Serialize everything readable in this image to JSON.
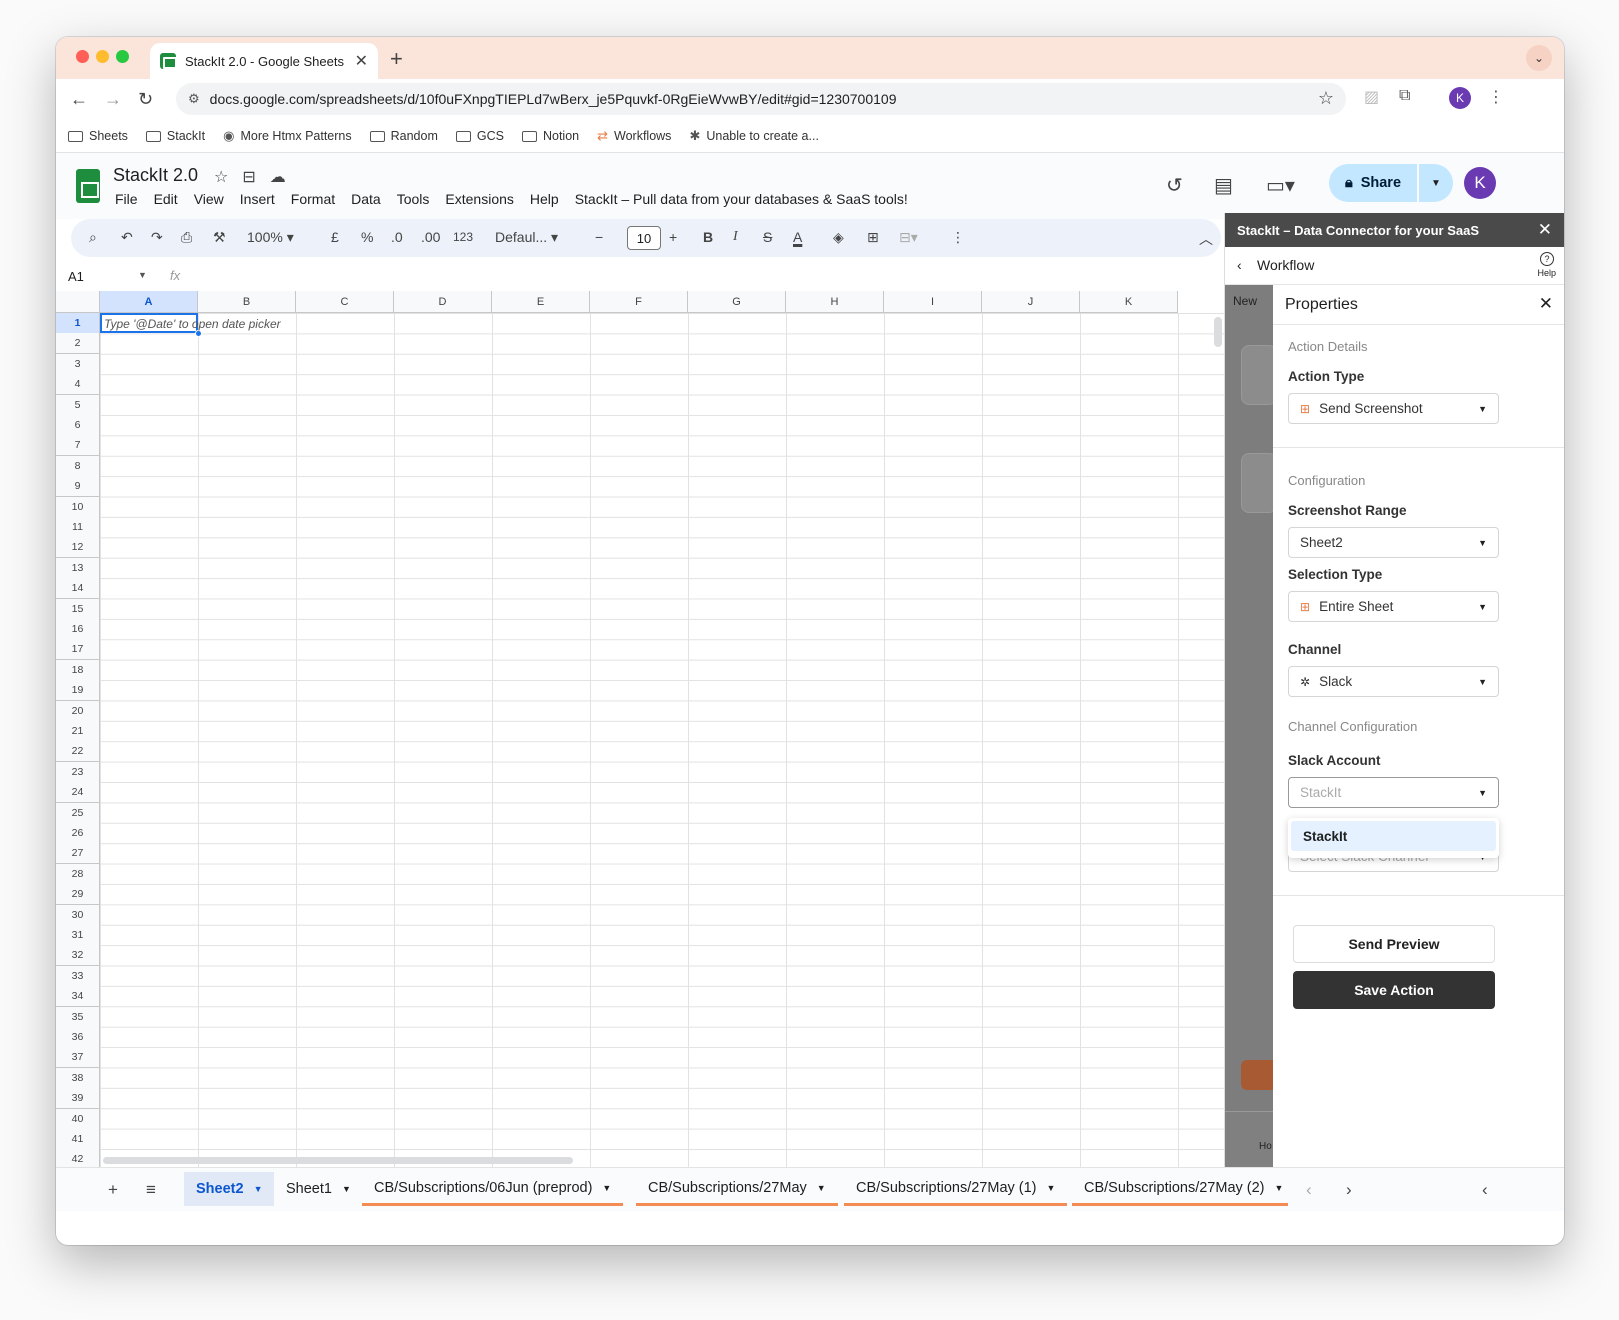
{
  "browser": {
    "tab_title": "StackIt 2.0 - Google Sheets",
    "tab_close": "✕",
    "new_tab": "+",
    "url": "docs.google.com/spreadsheets/d/10f0uFXnpgTIEPLd7wBerx_je5Pquvkf-0RgEieWvwBY/edit#gid=1230700109",
    "profile_initial": "K",
    "bookmarks": [
      {
        "label": "Sheets",
        "icon": "folder-icon"
      },
      {
        "label": "StackIt",
        "icon": "folder-icon"
      },
      {
        "label": "More Htmx Patterns",
        "icon": "globe-icon"
      },
      {
        "label": "Random",
        "icon": "folder-icon"
      },
      {
        "label": "GCS",
        "icon": "folder-icon"
      },
      {
        "label": "Notion",
        "icon": "folder-icon"
      },
      {
        "label": "Workflows",
        "icon": "workflow-icon"
      },
      {
        "label": "Unable to create a...",
        "icon": "bug-icon"
      }
    ]
  },
  "sheets": {
    "doc_title": "StackIt 2.0",
    "menu": [
      "File",
      "Edit",
      "View",
      "Insert",
      "Format",
      "Data",
      "Tools",
      "Extensions",
      "Help",
      "StackIt – Pull data from your databases & SaaS tools!"
    ],
    "share_label": "Share",
    "avatar_initial": "K",
    "toolbar": {
      "zoom": "100%",
      "currency": "£",
      "percent": "%",
      "dec_decrease": ".0",
      "dec_increase": ".00",
      "number_format": "123",
      "font": "Defaul...",
      "font_size": "10"
    },
    "name_box": "A1",
    "fx": "fx",
    "columns": [
      "A",
      "B",
      "C",
      "D",
      "E",
      "F",
      "G",
      "H",
      "I",
      "J",
      "K"
    ],
    "rows": [
      "1",
      "2",
      "3",
      "4",
      "5",
      "6",
      "7",
      "8",
      "9",
      "10",
      "11",
      "12",
      "13",
      "14",
      "15",
      "16",
      "17",
      "18",
      "19",
      "20",
      "21",
      "22",
      "23",
      "24",
      "25",
      "26",
      "27",
      "28",
      "29",
      "30",
      "31",
      "32",
      "33",
      "34",
      "35",
      "36",
      "37",
      "38",
      "39",
      "40",
      "41",
      "42"
    ],
    "a1_hint": "Type '@Date' to open date picker",
    "sheet_tabs": [
      {
        "label": "Sheet2",
        "active": true
      },
      {
        "label": "Sheet1",
        "active": false
      },
      {
        "label": "CB/Subscriptions/06Jun (preprod)",
        "active": false
      },
      {
        "label": "CB/Subscriptions/27May",
        "active": false
      },
      {
        "label": "CB/Subscriptions/27May (1)",
        "active": false
      },
      {
        "label": "CB/Subscriptions/27May (2)",
        "active": false
      }
    ]
  },
  "panel": {
    "title": "StackIt – Data Connector for your SaaS",
    "workflow_label": "Workflow",
    "help_label": "Help",
    "behind_new": "New",
    "behind_home": "Ho",
    "properties_title": "Properties",
    "action_details": "Action Details",
    "action_type_label": "Action Type",
    "action_type_value": "Send Screenshot",
    "configuration": "Configuration",
    "screenshot_range_label": "Screenshot Range",
    "screenshot_range_value": "Sheet2",
    "selection_type_label": "Selection Type",
    "selection_type_value": "Entire Sheet",
    "channel_label": "Channel",
    "channel_value": "Slack",
    "channel_config": "Channel Configuration",
    "slack_account_label": "Slack Account",
    "slack_account_placeholder": "StackIt",
    "slack_channel_placeholder": "Select Slack Channel",
    "dropdown_option": "StackIt",
    "send_preview": "Send Preview",
    "save_action": "Save Action"
  }
}
